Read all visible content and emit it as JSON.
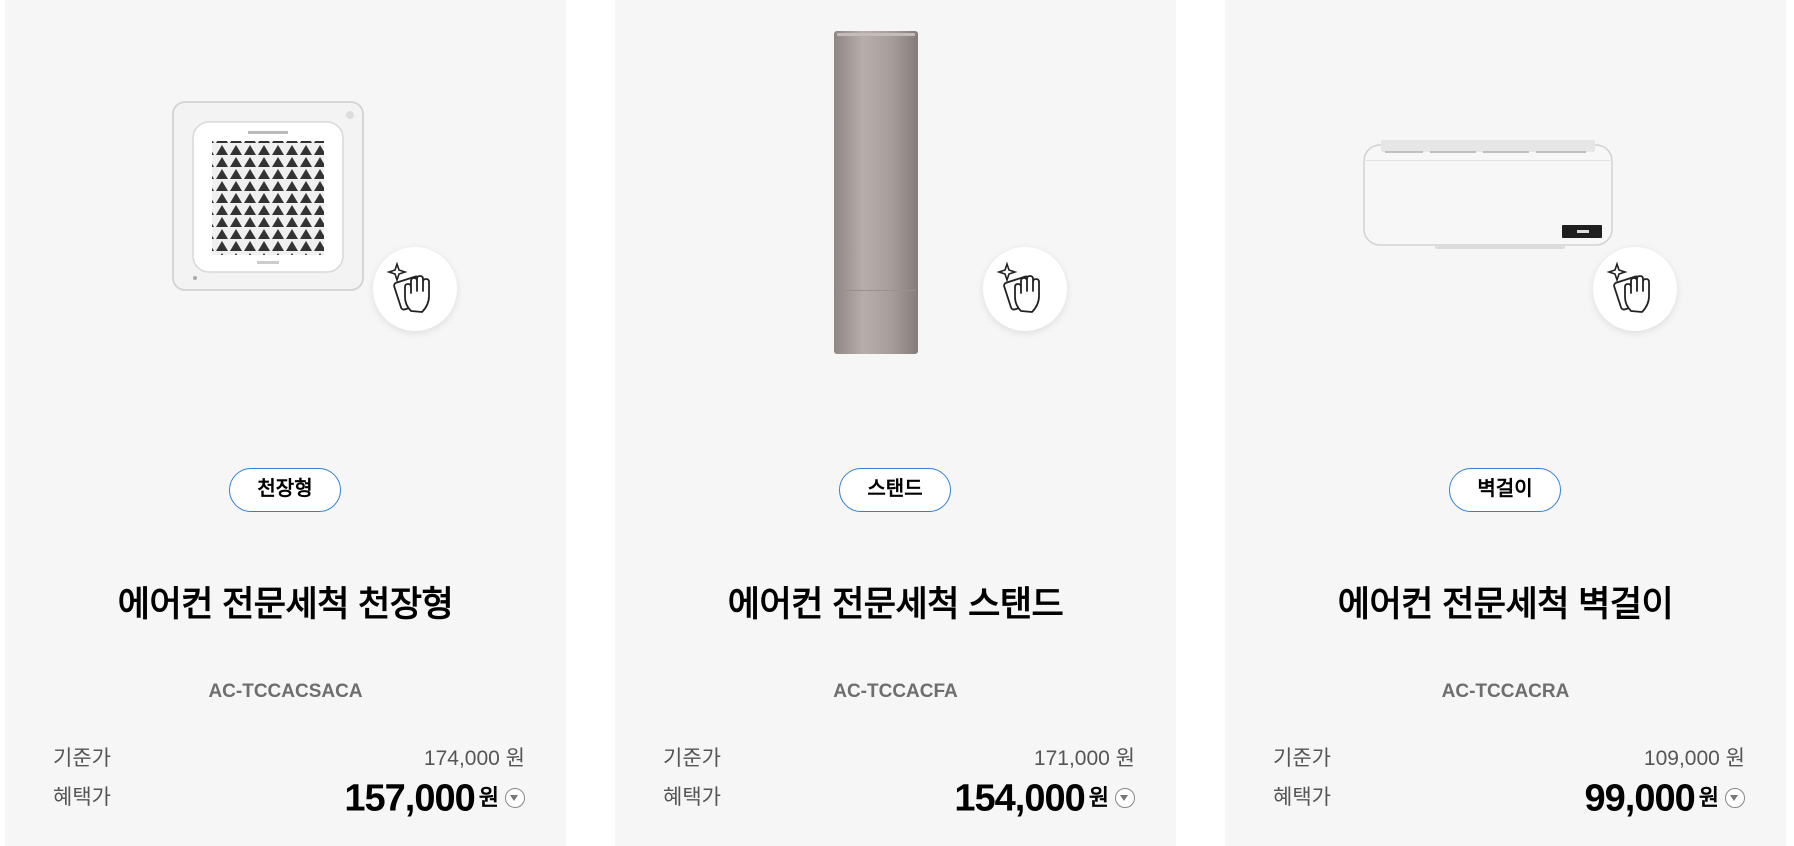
{
  "currency_unit": "원",
  "labels": {
    "standard_price": "기준가",
    "benefit_price": "혜택가"
  },
  "products": [
    {
      "image": "ceiling-cassette-ac-icon",
      "badge_icon": "cleaning-hand-icon",
      "type_tag": "천장형",
      "name": "에어컨 전문세척 천장형",
      "model": "AC-TCCACSACA",
      "standard_price": "174,000 원",
      "benefit_price": "157,000"
    },
    {
      "image": "standing-ac-icon",
      "badge_icon": "cleaning-hand-icon",
      "type_tag": "스탠드",
      "name": "에어컨 전문세척 스탠드",
      "model": "AC-TCCACFA",
      "standard_price": "171,000 원",
      "benefit_price": "154,000"
    },
    {
      "image": "wall-mounted-ac-icon",
      "badge_icon": "cleaning-hand-icon",
      "type_tag": "벽걸이",
      "name": "에어컨 전문세척 벽걸이",
      "model": "AC-TCCACRA",
      "standard_price": "109,000 원",
      "benefit_price": "99,000"
    }
  ],
  "colors": {
    "card_bg": "#f6f6f6",
    "tag_border": "#2f80d9"
  }
}
